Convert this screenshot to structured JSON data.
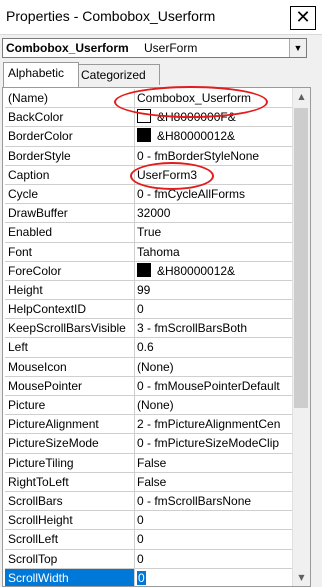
{
  "window": {
    "title": "Properties - Combobox_Userform",
    "close_glyph": "✕"
  },
  "object_selector": {
    "name": "Combobox_Userform",
    "type": "UserForm",
    "arrow_icon": "chevron-down-icon"
  },
  "tabs": [
    {
      "label": "Alphabetic",
      "active": true
    },
    {
      "label": "Categorized",
      "active": false
    }
  ],
  "properties": [
    {
      "name": "(Name)",
      "value": "Combobox_Userform"
    },
    {
      "name": "BackColor",
      "value": "&H8000000F&",
      "swatch": "#ffffff"
    },
    {
      "name": "BorderColor",
      "value": "&H80000012&",
      "swatch": "#000000"
    },
    {
      "name": "BorderStyle",
      "value": "0 - fmBorderStyleNone"
    },
    {
      "name": "Caption",
      "value": "UserForm3"
    },
    {
      "name": "Cycle",
      "value": "0 - fmCycleAllForms"
    },
    {
      "name": "DrawBuffer",
      "value": "32000"
    },
    {
      "name": "Enabled",
      "value": "True"
    },
    {
      "name": "Font",
      "value": "Tahoma"
    },
    {
      "name": "ForeColor",
      "value": "&H80000012&",
      "swatch": "#000000"
    },
    {
      "name": "Height",
      "value": "99"
    },
    {
      "name": "HelpContextID",
      "value": "0"
    },
    {
      "name": "KeepScrollBarsVisible",
      "value": "3 - fmScrollBarsBoth"
    },
    {
      "name": "Left",
      "value": "0.6"
    },
    {
      "name": "MouseIcon",
      "value": "(None)"
    },
    {
      "name": "MousePointer",
      "value": "0 - fmMousePointerDefault"
    },
    {
      "name": "Picture",
      "value": "(None)"
    },
    {
      "name": "PictureAlignment",
      "value": "2 - fmPictureAlignmentCen"
    },
    {
      "name": "PictureSizeMode",
      "value": "0 - fmPictureSizeModeClip"
    },
    {
      "name": "PictureTiling",
      "value": "False"
    },
    {
      "name": "RightToLeft",
      "value": "False"
    },
    {
      "name": "ScrollBars",
      "value": "0 - fmScrollBarsNone"
    },
    {
      "name": "ScrollHeight",
      "value": "0"
    },
    {
      "name": "ScrollLeft",
      "value": "0"
    },
    {
      "name": "ScrollTop",
      "value": "0"
    },
    {
      "name": "ScrollWidth",
      "value": "0",
      "selected": true
    }
  ],
  "colors": {
    "selection": "#0078d7",
    "annotation": "#e31b1b"
  }
}
